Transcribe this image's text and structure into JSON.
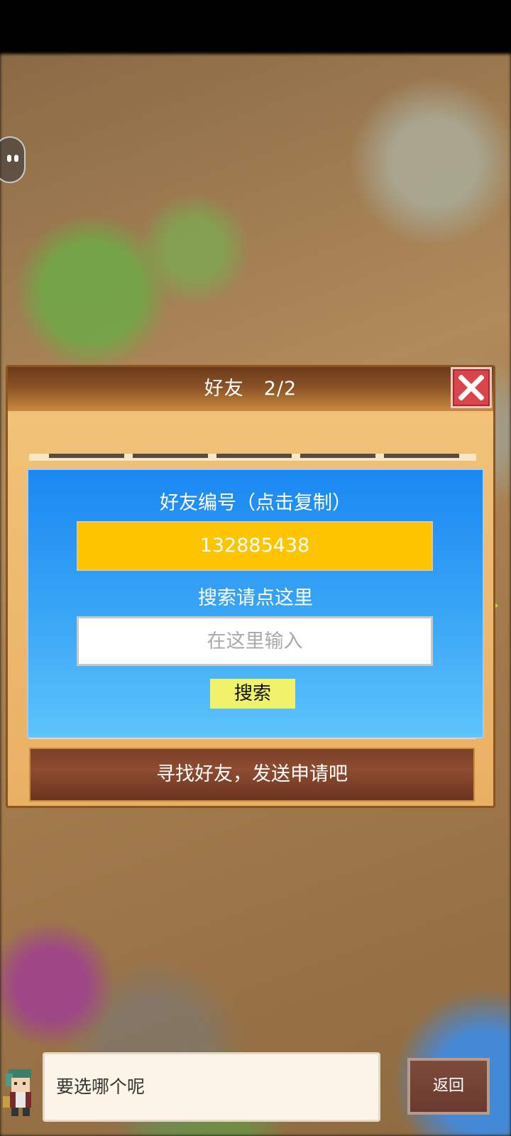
{
  "panel": {
    "title": "好友　2/2",
    "close_icon": "close-x-icon"
  },
  "friend_card": {
    "id_label": "好友编号（点击复制）",
    "id_value": "132885438",
    "search_hint": "搜索请点这里",
    "search_placeholder": "在这里输入",
    "search_button": "搜索"
  },
  "find_friends_button": "寻找好友，发送申请吧",
  "dialog": {
    "text": "要选哪个呢",
    "back_button": "返回"
  },
  "colors": {
    "id_box": "#ffc400",
    "search_button": "#f0f36a",
    "close_button": "#d9454a",
    "card_top": "#1a88f2",
    "card_bottom": "#5cc4fb",
    "nav_arrow": "#b9d632"
  }
}
